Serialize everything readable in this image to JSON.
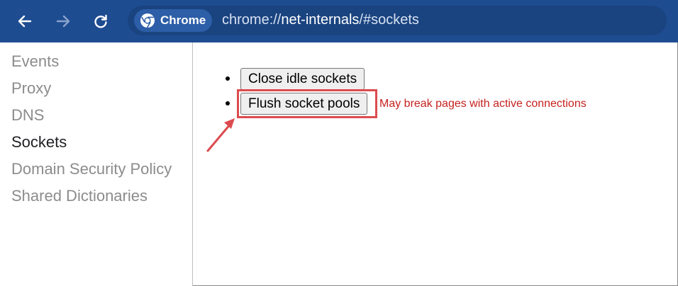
{
  "toolbar": {
    "back_icon": "arrow-left-icon",
    "forward_icon": "arrow-right-icon",
    "reload_icon": "reload-icon",
    "chip_icon": "chrome-logo-icon",
    "chip_label": "Chrome",
    "url_scheme": "chrome://",
    "url_host": "net-internals",
    "url_path": "/#sockets",
    "colors": {
      "toolbar_bg": "#1e4c91",
      "omnibox_bg": "#1a4480",
      "chip_bg": "#2d5ea8"
    }
  },
  "sidebar": {
    "items": [
      {
        "label": "Events",
        "active": false
      },
      {
        "label": "Proxy",
        "active": false
      },
      {
        "label": "DNS",
        "active": false
      },
      {
        "label": "Sockets",
        "active": true
      },
      {
        "label": "Domain Security Policy",
        "active": false
      },
      {
        "label": "Shared Dictionaries",
        "active": false
      }
    ]
  },
  "main": {
    "close_idle_label": "Close idle sockets",
    "flush_label": "Flush socket pools",
    "flush_warning": "May break pages with active connections",
    "annotation": {
      "highlight_color": "#dc4b4f",
      "arrow_icon": "annotation-arrow-icon"
    }
  }
}
